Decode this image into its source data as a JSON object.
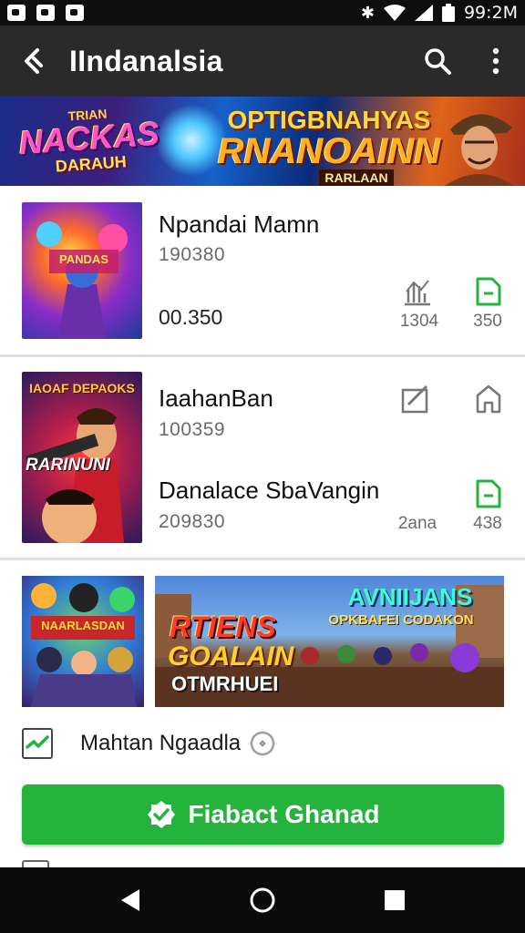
{
  "status_bar": {
    "time": "99:2M",
    "left_icons": [
      "gallery-icon",
      "image-icon",
      "camera-icon"
    ],
    "right_icons": [
      "bluetooth-icon",
      "wifi-icon",
      "signal-icon",
      "battery-icon"
    ]
  },
  "app_bar": {
    "title": "IIndanalsia",
    "icons": [
      "back-icon",
      "search-icon",
      "more-vert-icon"
    ]
  },
  "hero": {
    "left_small": "TRIAN",
    "left_big": "NACKAS",
    "left_sub": "DARAUH",
    "right_top": "OPTIGBNAHYAS",
    "right_big": "RNANOAINN",
    "right_sub": "RARLAAN"
  },
  "items": [
    {
      "title": "Npandai Mamn",
      "meta": "190380",
      "price": "00.350",
      "stat1_label": "1304",
      "stat2_label": "350",
      "thumb_text": "PANDAS"
    },
    {
      "title": "IaahanBan",
      "meta": "100359",
      "title2": "Danalace SbaVangin",
      "meta2": "209830",
      "stat1_label": "2ana",
      "stat2_label": "438",
      "thumb_top": "IAOAF DEPAOKS",
      "thumb_mid": "RARINUNI"
    }
  ],
  "promo": {
    "thumb_text": "NAARLASDAN",
    "banner_top": "AVNIIJANS",
    "banner_sub": "OPKBAFEI CODAKON",
    "banner_big1": "RTIENS",
    "banner_big2": "GOALAIN",
    "banner_big3": "OTMRHUEI"
  },
  "checkbox_label": "Mahtan Ngaadla",
  "cta_label": "Fiabact Ghanad",
  "colors": {
    "accent": "#25b33e",
    "app_bar": "#2a2a2a",
    "status_bar": "#0e0e0e"
  }
}
